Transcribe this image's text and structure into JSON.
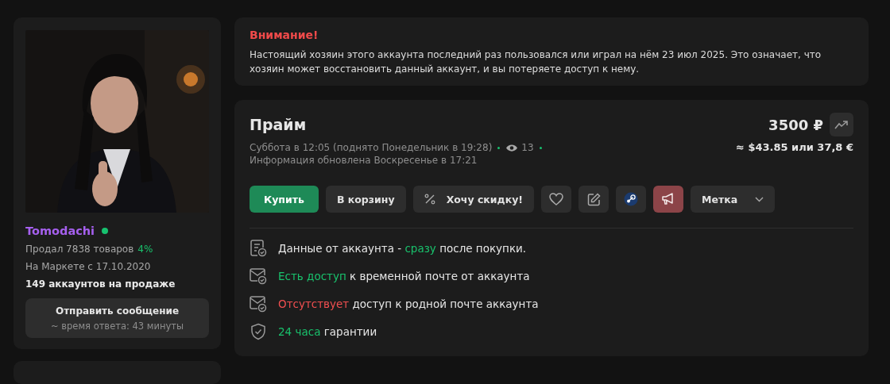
{
  "seller": {
    "name": "Tomodachi",
    "online": true,
    "sold": "Продал 7838 товаров",
    "rating": "4%",
    "since": "На Маркете с 17.10.2020",
    "on_sale": "149 аккаунтов на продаже",
    "message_button": {
      "label": "Отправить сообщение",
      "response_time": "~ время ответа: 43 минуты"
    }
  },
  "warning": {
    "title": "Внимание!",
    "text": "Настоящий хозяин этого аккаунта последний раз пользовался или играл на нём 23 июл 2025. Это означает, что хозяин может восстановить данный аккаунт, и вы потеряете доступ к нему."
  },
  "item": {
    "title": "Прайм",
    "price": "3500 ₽",
    "posted": "Суббота в 12:05 (поднято Понедельник в 19:28)",
    "views": "13",
    "updated": "Информация обновлена Воскресенье в 17:21",
    "converted": "≈ $43.85 или 37,8 €",
    "actions": {
      "buy": "Купить",
      "cart": "В корзину",
      "discount": "Хочу скидку!",
      "tag": "Метка"
    },
    "features": [
      {
        "kind": "data",
        "parts": [
          {
            "text": "Данные от аккаунта - ",
            "color": "#e6e6e6"
          },
          {
            "text": "сразу",
            "color": "#19c16c"
          },
          {
            "text": " после покупки.",
            "color": "#e6e6e6"
          }
        ]
      },
      {
        "kind": "mail",
        "parts": [
          {
            "text": "Есть доступ",
            "color": "#19c16c"
          },
          {
            "text": " к временной почте от аккаунта",
            "color": "#e6e6e6"
          }
        ]
      },
      {
        "kind": "mail",
        "parts": [
          {
            "text": "Отсутствует",
            "color": "#f14f50"
          },
          {
            "text": " доступ к родной почте аккаунта",
            "color": "#e6e6e6"
          }
        ]
      },
      {
        "kind": "guarantee",
        "parts": [
          {
            "text": "24 часа",
            "color": "#19c16c"
          },
          {
            "text": " гарантии",
            "color": "#e6e6e6"
          }
        ]
      }
    ]
  }
}
